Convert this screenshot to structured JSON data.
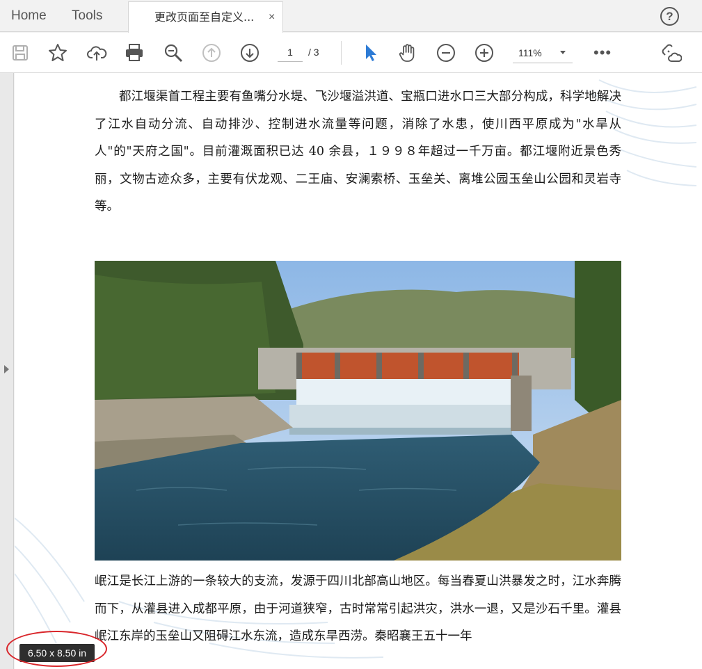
{
  "tabs": {
    "home": "Home",
    "tools": "Tools",
    "document_title": "更改页面至自定义...",
    "close_glyph": "×",
    "help_glyph": "?"
  },
  "toolbar": {
    "icons": [
      "save-icon",
      "star-icon",
      "cloud-upload-icon",
      "print-icon",
      "zoom-search-icon",
      "page-up-icon",
      "page-down-icon",
      "select-cursor-icon",
      "hand-icon",
      "zoom-out-icon",
      "zoom-in-icon",
      "more-icon",
      "link-cloud-icon"
    ],
    "page_current": "1",
    "page_total": "/ 3",
    "zoom_value": "111%",
    "more_glyph": "•••"
  },
  "document": {
    "paragraph1": "都江堰渠首工程主要有鱼嘴分水堤、飞沙堰溢洪道、宝瓶口进水口三大部分构成，科学地解决了江水自动分流、自动排沙、控制进水流量等问题，消除了水患，使川西平原成为\"水旱从人\"的\"天府之国\"。目前灌溉面积已达 40 余县，１９９８年超过一千万亩。都江堰附近景色秀丽，文物古迹众多，主要有伏龙观、二王庙、安澜索桥、玉垒关、离堆公园玉垒山公园和灵岩寺等。",
    "paragraph2": "岷江是长江上游的一条较大的支流，发源于四川北部高山地区。每当春夏山洪暴发之时，江水奔腾而下，从灌县进入成都平原，由于河道狭窄，古时常常引起洪灾，洪水一退，又是沙石千里。灌县岷江东岸的玉垒山又阻碍江水东流，造成东旱西涝。秦昭襄王五十一年"
  },
  "status": {
    "page_size": "6.50 x 8.50 in"
  },
  "colors": {
    "accent_blue": "#2d7bd5",
    "highlight_red": "#d9262b"
  }
}
